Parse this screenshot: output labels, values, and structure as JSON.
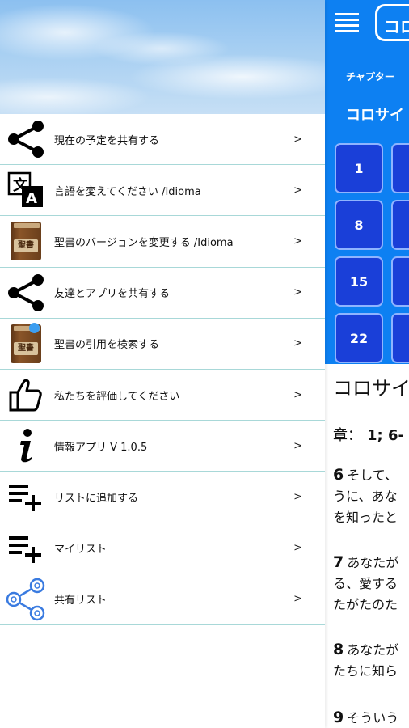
{
  "drawer": {
    "menu": [
      {
        "label": "現在の予定を共有する",
        "icon": "share-icon",
        "arrow": ">"
      },
      {
        "label": "言語を変えてください /Idioma",
        "icon": "translate-icon",
        "arrow": ">"
      },
      {
        "label": "聖書のバージョンを変更する /Idioma",
        "icon": "bible-book-icon",
        "arrow": ">"
      },
      {
        "label": "友達とアプリを共有する",
        "icon": "share-icon",
        "arrow": ">"
      },
      {
        "label": "聖書の引用を検索する",
        "icon": "bible-search-icon",
        "arrow": ">"
      },
      {
        "label": "私たちを評価してください",
        "icon": "thumbs-up-icon",
        "arrow": ">"
      },
      {
        "label": "情報アプリ V 1.0.5",
        "icon": "info-icon",
        "arrow": ">"
      },
      {
        "label": "リストに追加する",
        "icon": "playlist-add-icon",
        "arrow": ">"
      },
      {
        "label": "マイリスト",
        "icon": "playlist-add-icon",
        "arrow": ">"
      },
      {
        "label": "共有リスト",
        "icon": "shared-list-icon",
        "arrow": ">"
      }
    ],
    "book_icon_text": "聖書"
  },
  "app": {
    "book_button": "コロ",
    "chapter_label": "チャプター",
    "book_name": "コロサイ",
    "chapter_buttons": [
      "1",
      "8",
      "15",
      "22"
    ],
    "verse_title": "コロサイ",
    "chapter_ref_label": "章：",
    "chapter_ref_value": "1; 6-",
    "verses": [
      {
        "num": "6",
        "lines": [
          "そして、",
          "うに、あな",
          "を知ったと"
        ]
      },
      {
        "num": "7",
        "lines": [
          "あなたが",
          "る、愛する",
          "たがたのた"
        ]
      },
      {
        "num": "8",
        "lines": [
          "あなたが",
          "たちに知ら"
        ]
      },
      {
        "num": "9",
        "lines": [
          "そういう"
        ]
      }
    ]
  },
  "colors": {
    "header_blue": "#0d80f2",
    "chapter_button": "#1a3fd8",
    "divider": "#a8d8d8"
  }
}
